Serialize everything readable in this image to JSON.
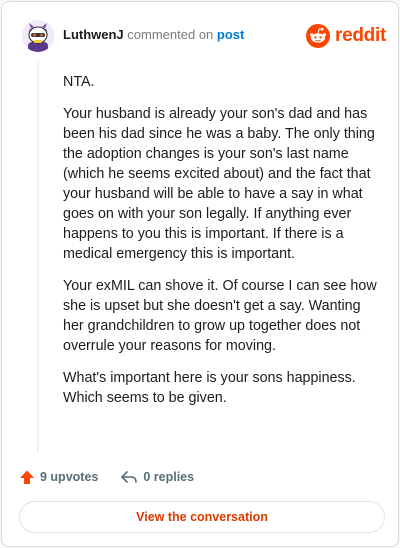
{
  "header": {
    "author": "LuthwenJ",
    "commented_on_text": "commented on",
    "post_link_label": "post",
    "brand_name": "reddit",
    "avatar_icon": "snoo-avatar-icon",
    "brand_icon": "reddit-snoo-icon"
  },
  "comment": {
    "paragraphs": [
      "NTA.",
      "Your husband is already your son's dad and has been his dad since he was a baby. The only thing the adoption changes is your son's last name (which he seems excited about) and the fact that your husband will be able to have a say in what goes on with your son legally. If anything ever happens to you this is important. If there is a medical emergency this is important.",
      "Your exMIL can shove it. Of course I can see how she is upset but she doesn't get a say. Wanting her grandchildren to grow up together does not overrule your reasons for moving.",
      "What's important here is your sons happiness. Which seems to be given."
    ]
  },
  "actions": {
    "upvotes_label": "9 upvotes",
    "replies_label": "0 replies",
    "upvote_icon": "upvote-arrow-icon",
    "reply_icon": "reply-arrow-icon"
  },
  "view_conversation_label": "View the conversation",
  "colors": {
    "brand": "#ff4500",
    "link": "#0079d3",
    "button_text": "#d93a00",
    "action_text": "#576f76"
  }
}
